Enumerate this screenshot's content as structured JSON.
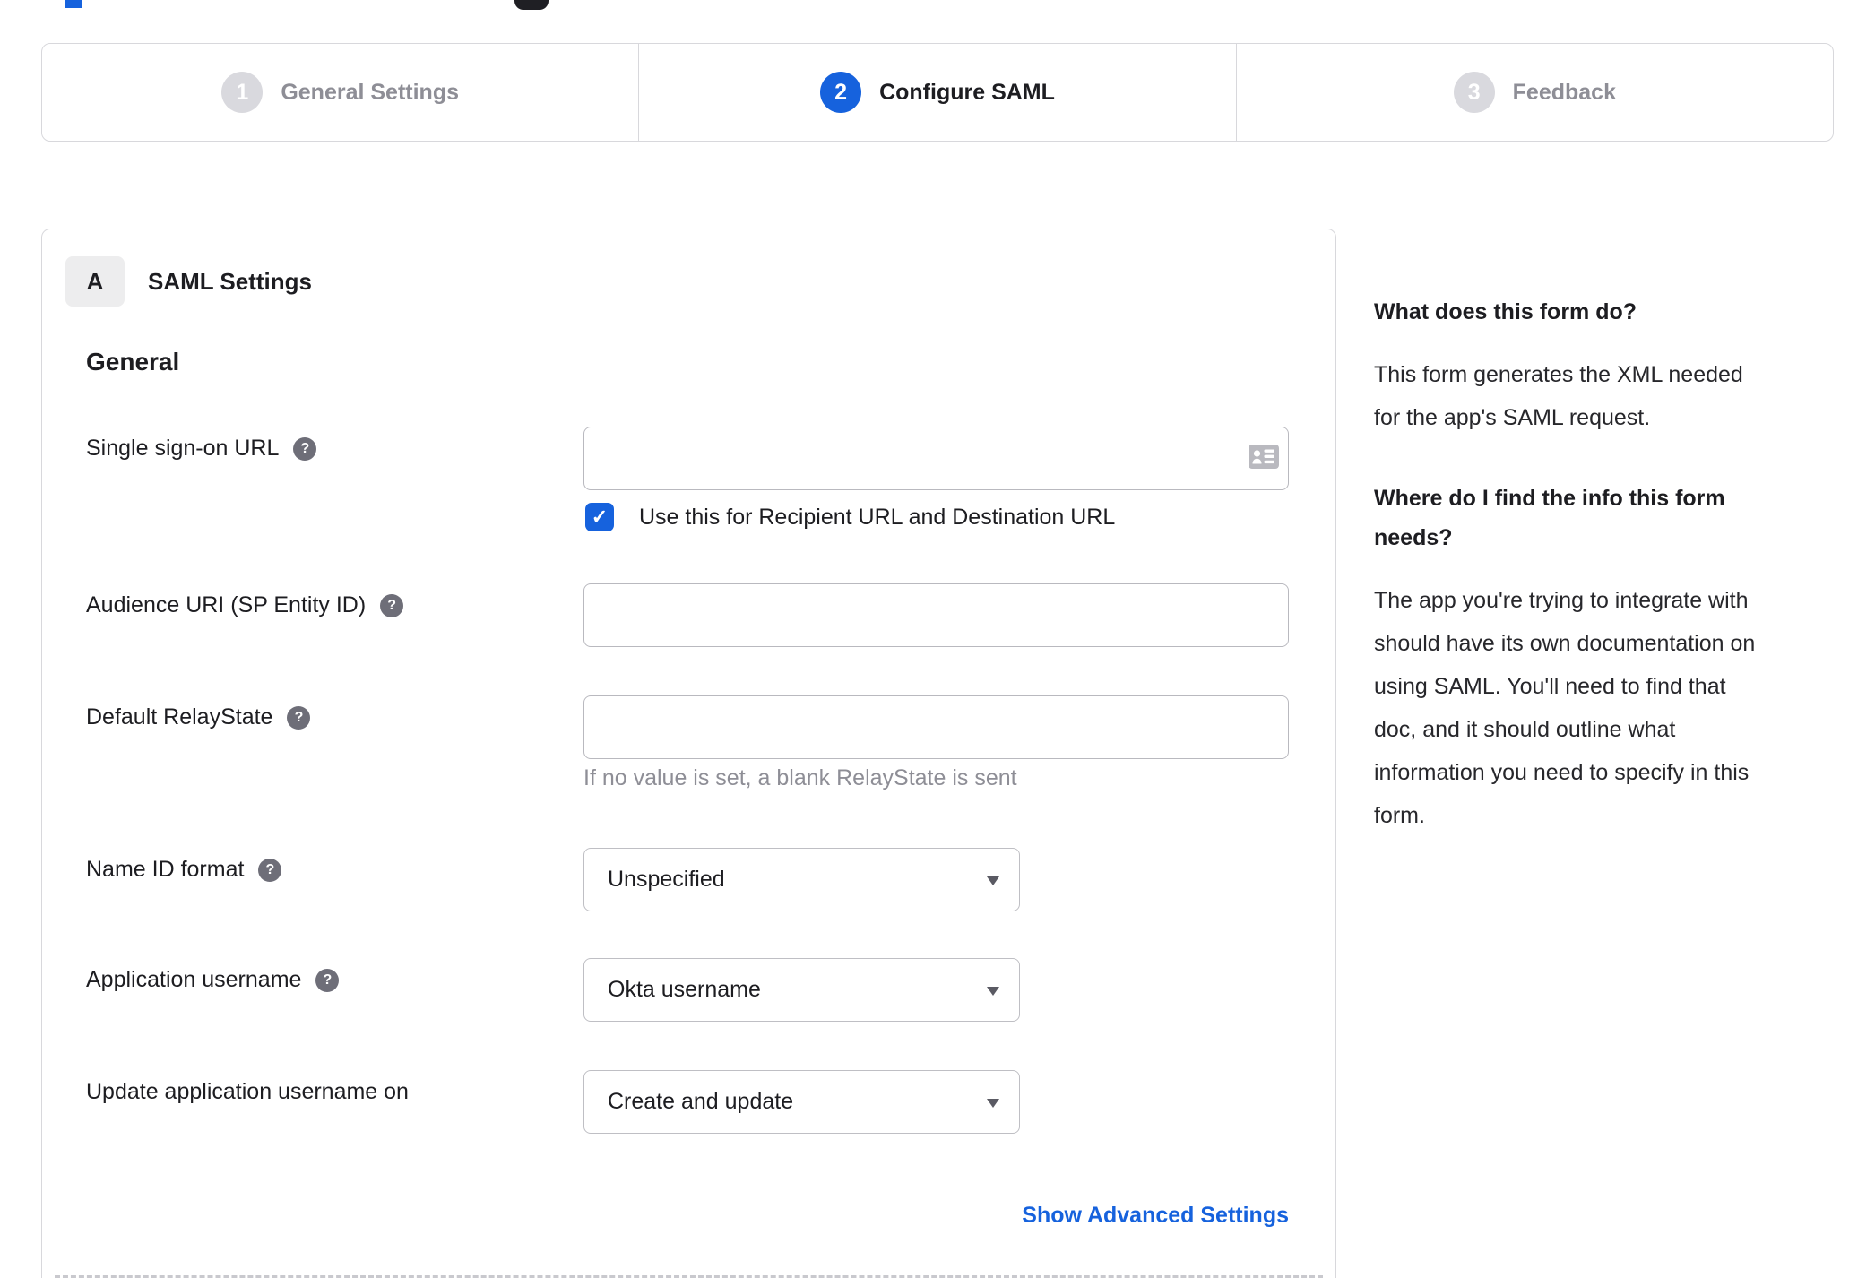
{
  "stepper": {
    "steps": [
      {
        "number": "1",
        "label": "General Settings",
        "state": "inactive"
      },
      {
        "number": "2",
        "label": "Configure SAML",
        "state": "active"
      },
      {
        "number": "3",
        "label": "Feedback",
        "state": "inactive"
      }
    ]
  },
  "panel": {
    "badge": "A",
    "title": "SAML Settings",
    "section_title": "General",
    "fields": {
      "sso_url": {
        "label": "Single sign-on URL",
        "value": "",
        "has_help": true
      },
      "sso_checkbox": {
        "label": "Use this for Recipient URL and Destination URL",
        "checked": true
      },
      "audience_uri": {
        "label": "Audience URI (SP Entity ID)",
        "value": "",
        "has_help": true
      },
      "relay_state": {
        "label": "Default RelayState",
        "value": "",
        "has_help": true,
        "hint": "If no value is set, a blank RelayState is sent"
      },
      "name_id_format": {
        "label": "Name ID format",
        "value": "Unspecified",
        "has_help": true
      },
      "app_username": {
        "label": "Application username",
        "value": "Okta username",
        "has_help": true
      },
      "update_username": {
        "label": "Update application username on",
        "value": "Create and update",
        "has_help": false
      }
    },
    "help_icon_glyph": "?",
    "advanced_link": "Show Advanced Settings"
  },
  "sidebar": {
    "sections": [
      {
        "heading": "What does this form do?",
        "body": "This form generates the XML needed\nfor the app's SAML request."
      },
      {
        "heading": "Where do I find the info this form\nneeds?",
        "body": "The app you're trying to integrate with\nshould have its own documentation on\nusing SAML. You'll need to find that\ndoc, and it should outline what\ninformation you need to specify in this\nform."
      }
    ]
  },
  "colors": {
    "accent_blue": "#1662dd",
    "text_dark": "#1d1d21",
    "text_muted": "#8e8e96",
    "step_inactive_circle": "#d9d9de",
    "panel_border": "#d8d8dc",
    "input_border": "#b9b9bf",
    "help_icon_bg": "#6e6e78",
    "card_icon_gray": "#b9b9bf"
  }
}
